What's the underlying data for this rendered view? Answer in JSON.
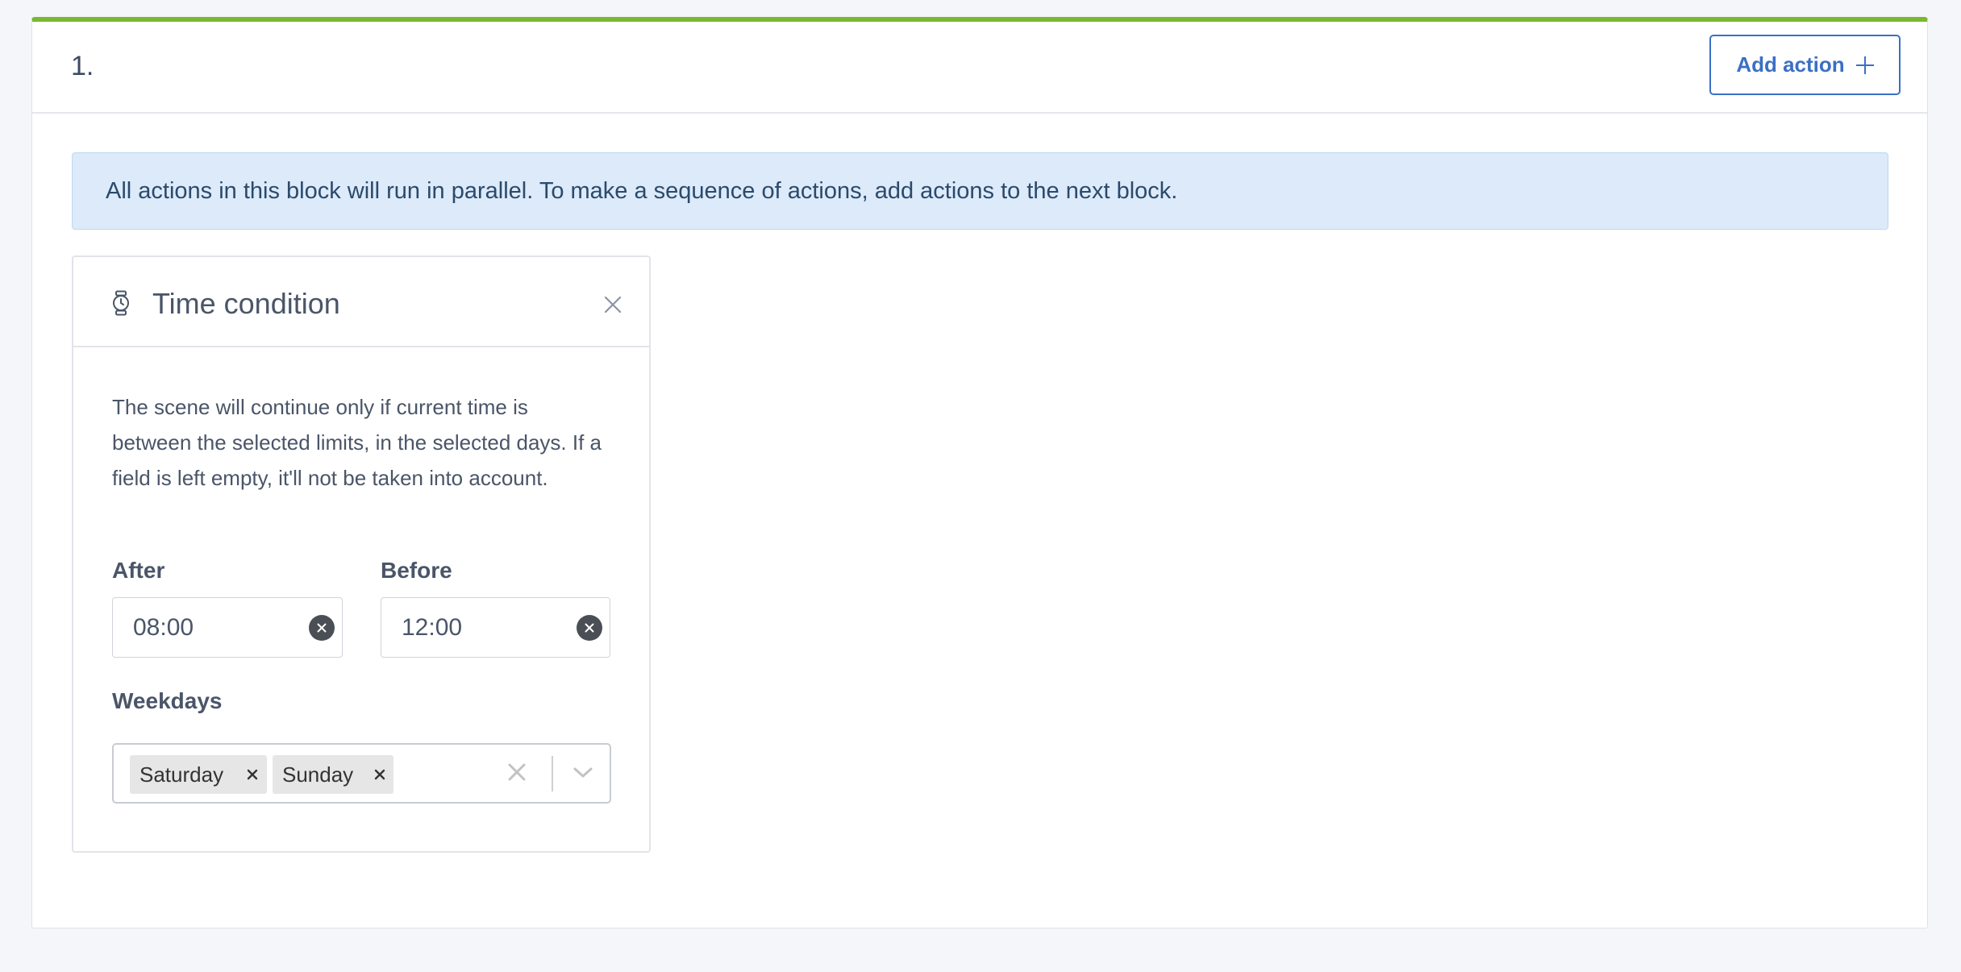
{
  "block": {
    "number": "1.",
    "add_action_label": "Add action",
    "info_text": "All actions in this block will run in parallel. To make a sequence of actions, add actions to the next block."
  },
  "card": {
    "title": "Time condition",
    "description": "The scene will continue only if current time is between the selected limits, in the selected days. If a field is left empty, it'll not be taken into account.",
    "after_label": "After",
    "after_value": "08:00",
    "before_label": "Before",
    "before_value": "12:00",
    "weekdays_label": "Weekdays",
    "weekdays": [
      "Saturday",
      "Sunday"
    ]
  },
  "colors": {
    "accent_bar": "#7cb82f",
    "primary": "#3b6fc5",
    "info_background": "#dceafa"
  },
  "icons": {
    "add": "plus-icon",
    "card": "watch-icon",
    "close": "close-icon",
    "clear": "clear-circle-icon",
    "dropdown": "chevron-down-icon"
  }
}
